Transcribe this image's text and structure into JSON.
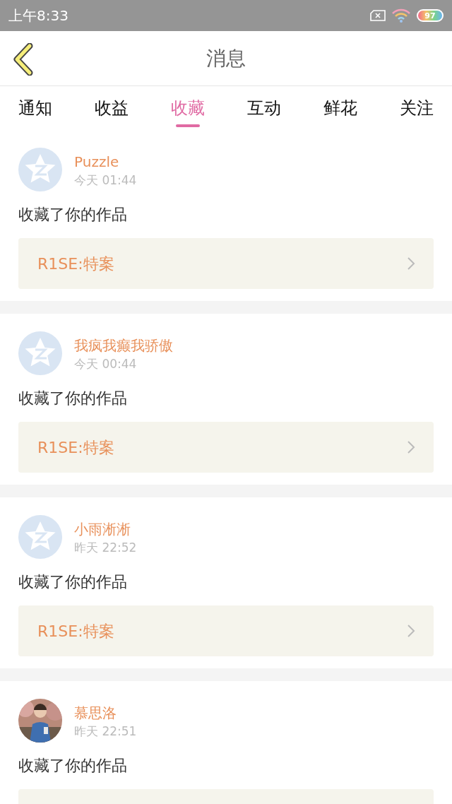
{
  "status_bar": {
    "time": "上午8:33",
    "battery": "97"
  },
  "header": {
    "title": "消息"
  },
  "tabs": [
    {
      "label": "通知",
      "selected": false
    },
    {
      "label": "收益",
      "selected": false
    },
    {
      "label": "收藏",
      "selected": true
    },
    {
      "label": "互动",
      "selected": false
    },
    {
      "label": "鲜花",
      "selected": false
    },
    {
      "label": "关注",
      "selected": false
    }
  ],
  "messages": [
    {
      "kind": "default",
      "name": "Puzzle",
      "time": "今天 01:44",
      "text": "收藏了你的作品",
      "link": "R1SE:特案"
    },
    {
      "kind": "default",
      "name": "我疯我癫我骄傲",
      "time": "今天 00:44",
      "text": "收藏了你的作品",
      "link": "R1SE:特案"
    },
    {
      "kind": "default",
      "name": "小雨淅淅",
      "time": "昨天 22:52",
      "text": "收藏了你的作品",
      "link": "R1SE:特案"
    },
    {
      "kind": "picture",
      "name": "慕思洛",
      "time": "昨天 22:51",
      "text": "收藏了你的作品"
    }
  ]
}
